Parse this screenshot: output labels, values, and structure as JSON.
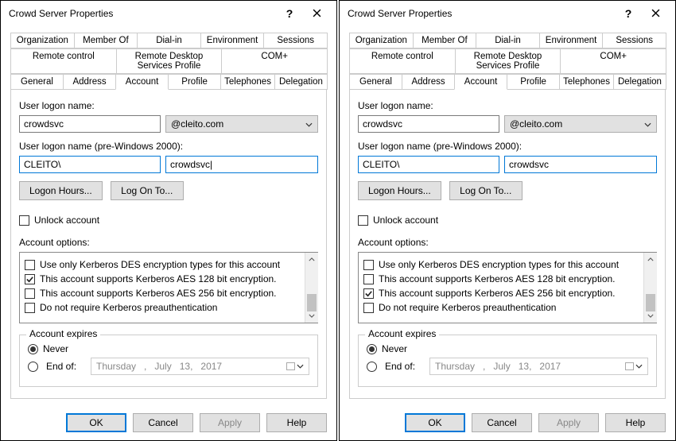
{
  "windows": [
    {
      "title": "Crowd Server Properties",
      "tabs_top": [
        "Organization",
        "Member Of",
        "Dial-in",
        "Environment",
        "Sessions"
      ],
      "tabs_mid": [
        "Remote control",
        "Remote Desktop Services Profile",
        "COM+"
      ],
      "tabs_bot": [
        "General",
        "Address",
        "Account",
        "Profile",
        "Telephones",
        "Delegation"
      ],
      "active_tab": "Account",
      "logon_label": "User logon name:",
      "logon_value": "crowdsvc",
      "domain": "@cleito.com",
      "pre2000_label": "User logon name (pre-Windows 2000):",
      "pre2000_domain": "CLEITO\\",
      "pre2000_user": "crowdsvc|",
      "btn_logon_hours": "Logon Hours...",
      "btn_log_on_to": "Log On To...",
      "unlock_label": "Unlock account",
      "unlock_checked": false,
      "options_label": "Account options:",
      "options": [
        {
          "label": "Use only Kerberos DES encryption types for this account",
          "checked": false
        },
        {
          "label": "This account supports Kerberos AES 128 bit encryption.",
          "checked": true
        },
        {
          "label": "This account supports Kerberos AES 256 bit encryption.",
          "checked": false
        },
        {
          "label": "Do not require Kerberos preauthentication",
          "checked": false
        }
      ],
      "expires_legend": "Account expires",
      "never_label": "Never",
      "endof_label": "End of:",
      "expires_never": true,
      "date_weekday": "Thursday",
      "date_sep": ",",
      "date_month": "July",
      "date_day": "13,",
      "date_year": "2017",
      "btn_ok": "OK",
      "btn_cancel": "Cancel",
      "btn_apply": "Apply",
      "btn_help": "Help"
    },
    {
      "title": "Crowd Server Properties",
      "tabs_top": [
        "Organization",
        "Member Of",
        "Dial-in",
        "Environment",
        "Sessions"
      ],
      "tabs_mid": [
        "Remote control",
        "Remote Desktop Services Profile",
        "COM+"
      ],
      "tabs_bot": [
        "General",
        "Address",
        "Account",
        "Profile",
        "Telephones",
        "Delegation"
      ],
      "active_tab": "Account",
      "logon_label": "User logon name:",
      "logon_value": "crowdsvc",
      "domain": "@cleito.com",
      "pre2000_label": "User logon name (pre-Windows 2000):",
      "pre2000_domain": "CLEITO\\",
      "pre2000_user": "crowdsvc",
      "btn_logon_hours": "Logon Hours...",
      "btn_log_on_to": "Log On To...",
      "unlock_label": "Unlock account",
      "unlock_checked": false,
      "options_label": "Account options:",
      "options": [
        {
          "label": "Use only Kerberos DES encryption types for this account",
          "checked": false
        },
        {
          "label": "This account supports Kerberos AES 128 bit encryption.",
          "checked": false
        },
        {
          "label": "This account supports Kerberos AES 256 bit encryption.",
          "checked": true
        },
        {
          "label": "Do not require Kerberos preauthentication",
          "checked": false
        }
      ],
      "expires_legend": "Account expires",
      "never_label": "Never",
      "endof_label": "End of:",
      "expires_never": true,
      "date_weekday": "Thursday",
      "date_sep": ",",
      "date_month": "July",
      "date_day": "13,",
      "date_year": "2017",
      "btn_ok": "OK",
      "btn_cancel": "Cancel",
      "btn_apply": "Apply",
      "btn_help": "Help"
    }
  ]
}
